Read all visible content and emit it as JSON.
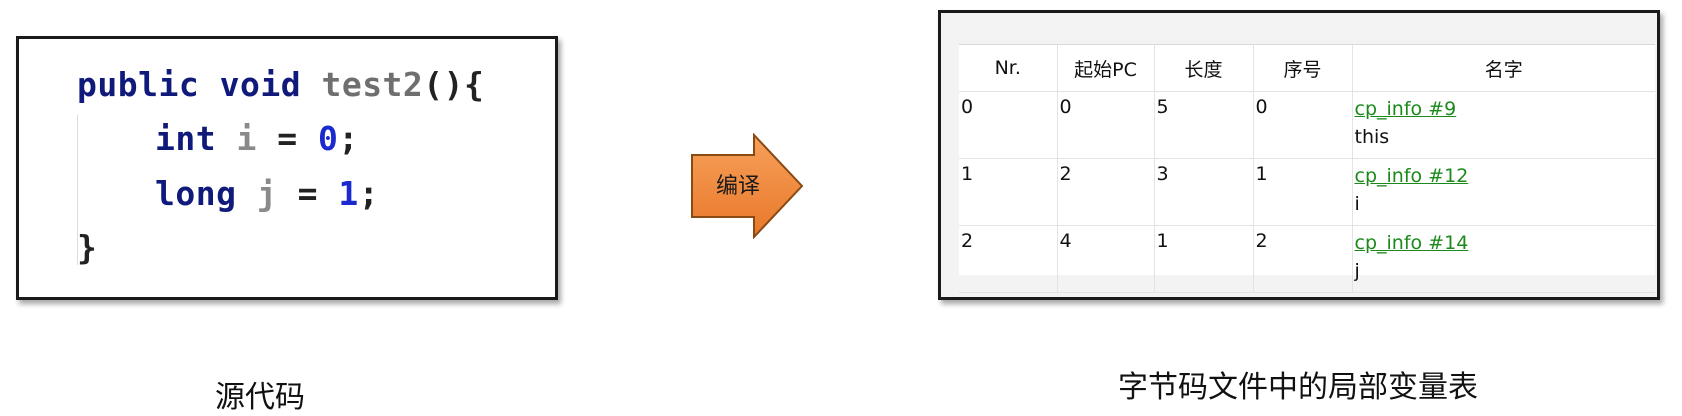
{
  "source_code": {
    "line1": {
      "kw1": "public",
      "kw2": "void",
      "fn": "test2",
      "rest": "(){"
    },
    "line2": {
      "kw": "int",
      "var": "i",
      "eq": "=",
      "num": "0",
      "semi": ";"
    },
    "line3": {
      "kw": "long",
      "var": "j",
      "eq": "=",
      "num": "1",
      "semi": ";"
    },
    "line4": "}"
  },
  "arrow_label": "编译",
  "table": {
    "headers": [
      "Nr.",
      "起始PC",
      "长度",
      "序号",
      "名字"
    ],
    "rows": [
      {
        "nr": "0",
        "start_pc": "0",
        "length": "5",
        "index": "0",
        "link": "cp_info #9",
        "name": "this"
      },
      {
        "nr": "1",
        "start_pc": "2",
        "length": "3",
        "index": "1",
        "link": "cp_info #12",
        "name": "i"
      },
      {
        "nr": "2",
        "start_pc": "4",
        "length": "1",
        "index": "2",
        "link": "cp_info #14",
        "name": "j"
      }
    ]
  },
  "captions": {
    "source": "源代码",
    "table": "字节码文件中的局部变量表"
  },
  "colors": {
    "keyword": "#101a7a",
    "number": "#1a2ad0",
    "arrow_fill": "#f28a3c",
    "link": "#1b8a1b"
  }
}
